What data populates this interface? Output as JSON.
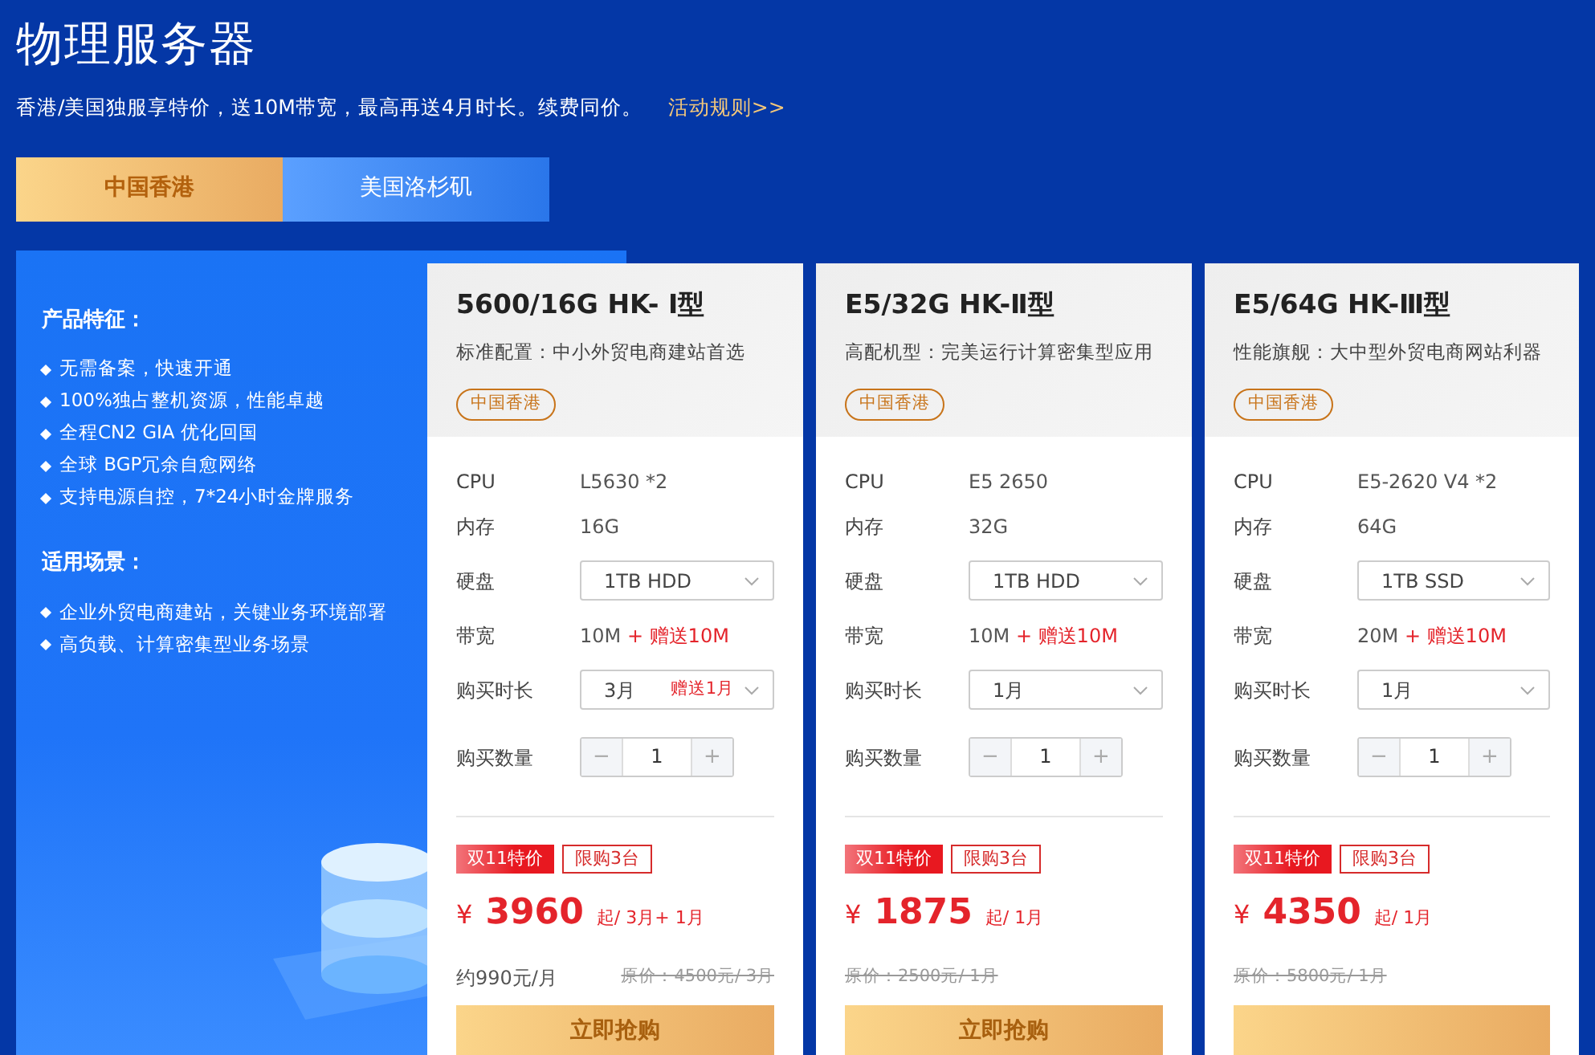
{
  "title": "物理服务器",
  "subtitle": "香港/美国独服享特价，送10M带宽，最高再送4月时长。续费同价。",
  "rules_link": "活动规则>>",
  "tabs": [
    {
      "label": "中国香港",
      "selected": true
    },
    {
      "label": "美国洛杉矶",
      "selected": false
    }
  ],
  "features": {
    "heading": "产品特征：",
    "items": [
      "无需备案，快速开通",
      "100%独占整机资源，性能卓越",
      "全程CN2 GIA 优化回国",
      "全球 BGP冗余自愈网络",
      "支持电源自控，7*24小时金牌服务"
    ]
  },
  "scenarios": {
    "heading": "适用场景：",
    "items": [
      "企业外贸电商建站，关键业务环境部署",
      "高负载、计算密集型业务场景"
    ]
  },
  "cards": [
    {
      "name": "5600/16G HK- Ⅰ型",
      "desc": "标准配置：中小外贸电商建站首选",
      "tag": "中国香港",
      "cpu_label": "CPU",
      "cpu": "L5630 *2",
      "ram_label": "内存",
      "ram": "16G",
      "disk_label": "硬盘",
      "disk": "1TB HDD",
      "bw_label": "带宽",
      "bw": "10M",
      "bw_bonus": "+ 赠送10M",
      "dur_label": "购买时长",
      "duration": "3月",
      "duration_bonus": "赠送1月",
      "qty_label": "购买数量",
      "minus": "−",
      "qty": "1",
      "plus": "+",
      "promo": "双11特价",
      "limit": "限购3台",
      "currency": "¥",
      "price": "3960",
      "price_unit": "起/ 3月+ 1月",
      "monthly": "约990元/月",
      "original": "原价：4500元/ 3月",
      "button": "立即抢购"
    },
    {
      "name": "E5/32G HK-Ⅱ型",
      "desc": "高配机型：完美运行计算密集型应用",
      "tag": "中国香港",
      "cpu_label": "CPU",
      "cpu": "E5 2650",
      "ram_label": "内存",
      "ram": "32G",
      "disk_label": "硬盘",
      "disk": "1TB HDD",
      "bw_label": "带宽",
      "bw": "10M",
      "bw_bonus": "+ 赠送10M",
      "dur_label": "购买时长",
      "duration": "1月",
      "qty_label": "购买数量",
      "minus": "−",
      "qty": "1",
      "plus": "+",
      "promo": "双11特价",
      "limit": "限购3台",
      "currency": "¥",
      "price": "1875",
      "price_unit": "起/ 1月",
      "original": "原价：2500元/ 1月",
      "button": "立即抢购"
    },
    {
      "name": "E5/64G HK-Ⅲ型",
      "desc": "性能旗舰：大中型外贸电商网站利器",
      "tag": "中国香港",
      "cpu_label": "CPU",
      "cpu": "E5-2620 V4 *2",
      "ram_label": "内存",
      "ram": "64G",
      "disk_label": "硬盘",
      "disk": "1TB SSD",
      "bw_label": "带宽",
      "bw": "20M",
      "bw_bonus": "+ 赠送10M",
      "dur_label": "购买时长",
      "duration": "1月",
      "qty_label": "购买数量",
      "minus": "−",
      "qty": "1",
      "plus": "+",
      "promo": "双11特价",
      "limit": "限购3台",
      "currency": "¥",
      "price": "4350",
      "price_unit": "起/ 1月",
      "original": "原价：5800元/ 1月"
    }
  ]
}
